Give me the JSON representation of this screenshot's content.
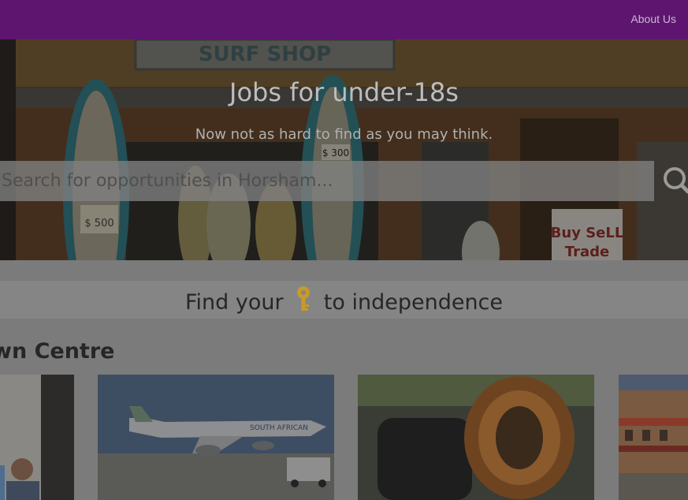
{
  "nav": {
    "about_label": "About Us"
  },
  "hero": {
    "title": "Jobs for under-18s",
    "subtitle": "Now not as hard to find as you may think.",
    "search_placeholder": "Search for opportunities in Horsham...",
    "shop_sign": "SURF SHOP",
    "price_tag_1": "$ 300",
    "price_tag_2": "$ 500",
    "sale_sign_line1": "Buy SeLL",
    "sale_sign_line2": "Trade",
    "aircraft_livery": "SOUTH AFRICAN"
  },
  "tagline": {
    "before": "Find your",
    "after": "to independence",
    "icon": "key-icon"
  },
  "section": {
    "title": "wn Centre"
  },
  "colors": {
    "navbar": "#5e1570",
    "overlay": "#7b7b7b",
    "key": "#c79a2a"
  }
}
